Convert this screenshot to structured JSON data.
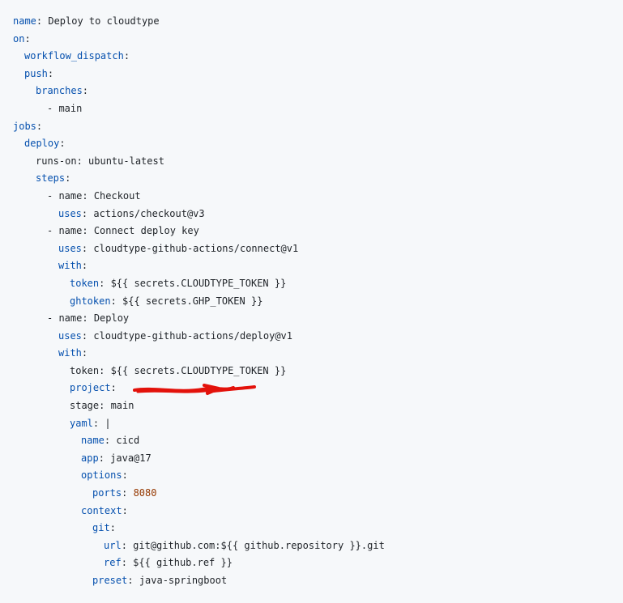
{
  "colors": {
    "background": "#f6f8fa",
    "key": "#0550ae",
    "text": "#1f2328",
    "number": "#953800",
    "redaction": "#e3120b"
  },
  "code": {
    "lines": [
      {
        "indent": 0,
        "key": "name",
        "value": "Deploy to cloudtype",
        "key_colored": true
      },
      {
        "indent": 0,
        "key": "on",
        "value": "",
        "key_colored": true
      },
      {
        "indent": 1,
        "key": "workflow_dispatch",
        "value": "",
        "key_colored": true
      },
      {
        "indent": 1,
        "key": "push",
        "value": "",
        "key_colored": true
      },
      {
        "indent": 2,
        "key": "branches",
        "value": "",
        "key_colored": true
      },
      {
        "indent": 3,
        "text": "- main"
      },
      {
        "indent": 0,
        "key": "jobs",
        "value": "",
        "key_colored": true
      },
      {
        "indent": 1,
        "key": "deploy",
        "value": "",
        "key_colored": true
      },
      {
        "indent": 2,
        "key": "runs-on",
        "value": "ubuntu-latest",
        "key_colored": false
      },
      {
        "indent": 2,
        "key": "steps",
        "value": "",
        "key_colored": true
      },
      {
        "indent": 3,
        "key": "- name",
        "value": "Checkout",
        "key_colored": false
      },
      {
        "indent": 4,
        "key": "uses",
        "value": "actions/checkout@v3",
        "key_colored": true
      },
      {
        "indent": 3,
        "key": "- name",
        "value": "Connect deploy key",
        "key_colored": false
      },
      {
        "indent": 4,
        "key": "uses",
        "value": "cloudtype-github-actions/connect@v1",
        "key_colored": true
      },
      {
        "indent": 4,
        "key": "with",
        "value": "",
        "key_colored": true
      },
      {
        "indent": 5,
        "key": "token",
        "value": "${{ secrets.CLOUDTYPE_TOKEN }}",
        "key_colored": true
      },
      {
        "indent": 5,
        "key": "ghtoken",
        "value": "${{ secrets.GHP_TOKEN }}",
        "key_colored": true
      },
      {
        "indent": 3,
        "key": "- name",
        "value": "Deploy",
        "key_colored": false
      },
      {
        "indent": 4,
        "key": "uses",
        "value": "cloudtype-github-actions/deploy@v1",
        "key_colored": true
      },
      {
        "indent": 4,
        "key": "with",
        "value": "",
        "key_colored": true
      },
      {
        "indent": 5,
        "key": "token",
        "value": "${{ secrets.CLOUDTYPE_TOKEN }}",
        "key_colored": false
      },
      {
        "indent": 5,
        "key": "project",
        "value": "",
        "key_colored": true,
        "redacted": true
      },
      {
        "indent": 5,
        "key": "stage",
        "value": "main",
        "key_colored": false
      },
      {
        "indent": 5,
        "key": "yaml",
        "value": "|",
        "key_colored": true
      },
      {
        "indent": 6,
        "key": "name",
        "value": "cicd",
        "key_colored": true
      },
      {
        "indent": 6,
        "key": "app",
        "value": "java@17",
        "key_colored": true
      },
      {
        "indent": 6,
        "key": "options",
        "value": "",
        "key_colored": true
      },
      {
        "indent": 7,
        "key": "ports",
        "value": "8080",
        "key_colored": true,
        "number": true
      },
      {
        "indent": 6,
        "key": "context",
        "value": "",
        "key_colored": true
      },
      {
        "indent": 7,
        "key": "git",
        "value": "",
        "key_colored": true
      },
      {
        "indent": 8,
        "key": "url",
        "value": "git@github.com:${{ github.repository }}.git",
        "key_colored": true
      },
      {
        "indent": 8,
        "key": "ref",
        "value": "${{ github.ref }}",
        "key_colored": true
      },
      {
        "indent": 7,
        "key": "preset",
        "value": "java-springboot",
        "key_colored": true
      }
    ]
  }
}
